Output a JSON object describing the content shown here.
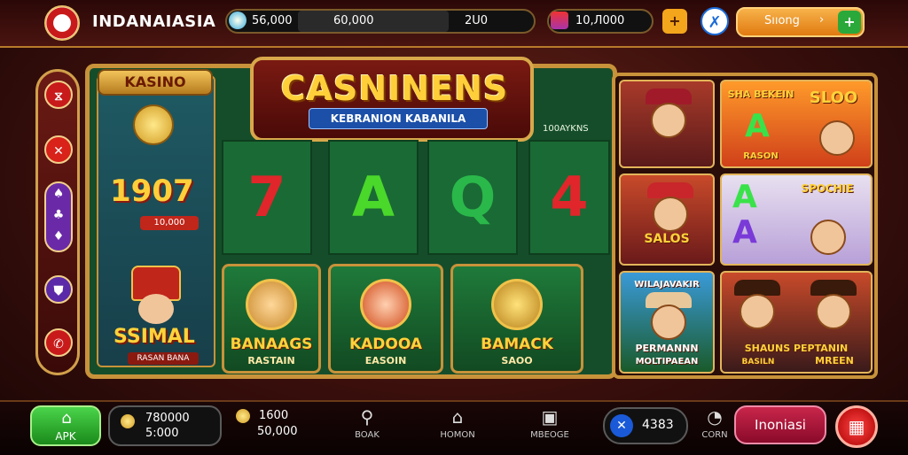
{
  "header": {
    "brand": "INDANAIASIA",
    "balance_left": "56,000",
    "balance_mid": "60,000",
    "balance_right": "2U0",
    "coins": "10,Л000",
    "plus_label": "+",
    "shop_label": "Sııong",
    "shop_arrow": "›",
    "shop_plus": "+"
  },
  "sidebar": {
    "items": [
      {
        "icon": "chevrons-icon",
        "glyph": "⧖",
        "color": "#c81a1a"
      },
      {
        "icon": "cross-icon",
        "glyph": "✕",
        "color": "#d8221a"
      },
      {
        "icon": "card-suits-icon",
        "glyph": "♠",
        "color": "#6a2aa8"
      },
      {
        "icon": "shield-icon",
        "glyph": "⛊",
        "color": "#5a2aa8"
      },
      {
        "icon": "phone-icon",
        "glyph": "✆",
        "color": "#c81a1a"
      }
    ]
  },
  "board": {
    "kasino_label": "KASINO",
    "jackpot": "1907",
    "jackpot_sub": "10,000",
    "title": "CASNINENS",
    "subtitle": "KEBRANION KABANILA",
    "reel_caption": "100AYKNS",
    "reels": [
      {
        "symbol": "7",
        "color": "#e0262a"
      },
      {
        "symbol": "A",
        "color": "#4ad82a"
      },
      {
        "symbol": "Q",
        "color": "#2ab84a"
      },
      {
        "symbol": "4",
        "color": "#e0262a"
      }
    ],
    "hero_caption": "SSIMAL",
    "hero_sub": "RASAN BANA",
    "games": [
      {
        "title": "BANAAGS",
        "sub": "RASTAIN"
      },
      {
        "title": "KADOOA",
        "sub": "EASOIN"
      },
      {
        "title": "BAMACK",
        "sub": "SAOO"
      }
    ]
  },
  "right_grid": {
    "tiles": [
      {
        "top": "",
        "label": ""
      },
      {
        "top": "SHA BEKEIN",
        "label": "RASON",
        "extra": "SLOO"
      },
      {
        "top": "",
        "label": "SALOS"
      },
      {
        "top": "",
        "label": "SPOCHIE"
      },
      {
        "top": "WILAJAVAKIR",
        "label": "MOLTIPAEAN",
        "label2": "PERMANNN"
      },
      {
        "top": "",
        "label": "MREEN",
        "label2": "SHAUNS  PEPTANIN",
        "extra": "BASILN"
      }
    ]
  },
  "footer": {
    "apk_label": "APK",
    "bal_top": "780000",
    "bal_bottom": "5:000",
    "bal2_top": "1600",
    "bal2_bottom": "50,000",
    "nav": [
      {
        "icon": "search-icon",
        "glyph": "⚲",
        "label": "BOAK"
      },
      {
        "icon": "home-icon",
        "glyph": "⌂",
        "label": "HOMON"
      },
      {
        "icon": "profile-icon",
        "glyph": "▣",
        "label": "MBEOGE"
      }
    ],
    "x_value": "4383",
    "chat_label": "CORN",
    "info_label": "Inoniasi",
    "menu_glyph": "▦"
  }
}
